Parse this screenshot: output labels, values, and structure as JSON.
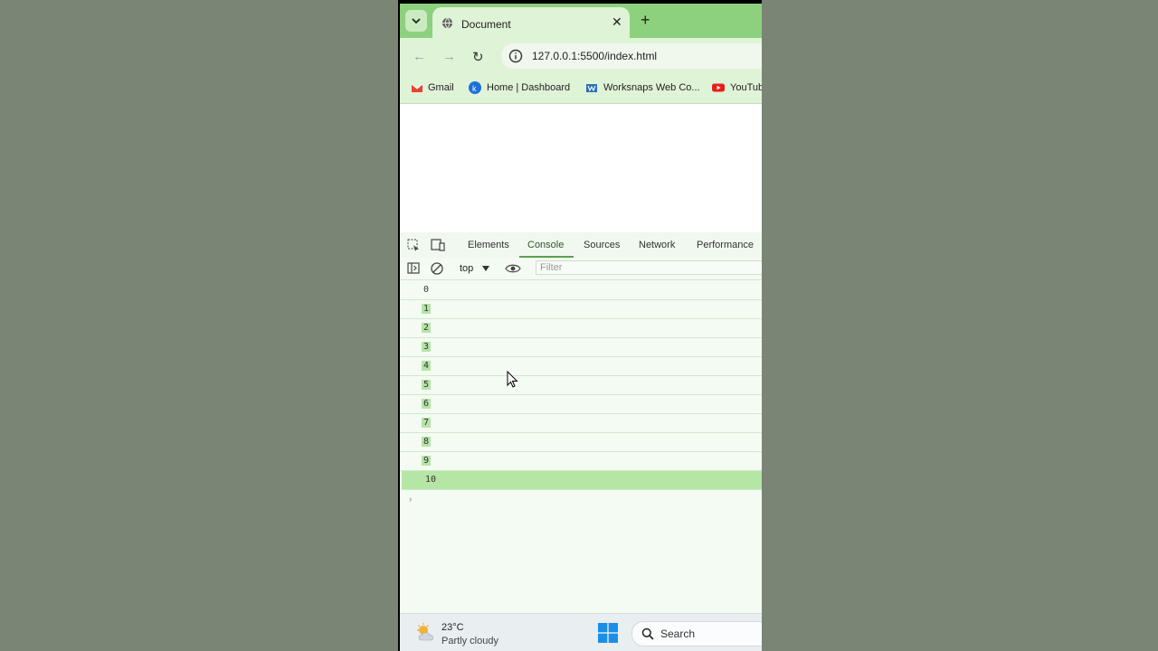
{
  "browser": {
    "tab_title": "Document",
    "url": "127.0.0.1:5500/index.html",
    "bookmarks": [
      {
        "label": "Gmail",
        "icon": "gmail-icon"
      },
      {
        "label": "Home | Dashboard",
        "icon": "k-icon"
      },
      {
        "label": "Worksnaps Web Co...",
        "icon": "worksnaps-icon"
      },
      {
        "label": "YouTub",
        "icon": "youtube-icon"
      }
    ]
  },
  "devtools": {
    "tabs": [
      "Elements",
      "Console",
      "Sources",
      "Network",
      "Performance"
    ],
    "active_tab": "Console",
    "context": "top",
    "filter_placeholder": "Filter",
    "logs": [
      "0",
      "1",
      "2",
      "3",
      "4",
      "5",
      "6",
      "7",
      "8",
      "9",
      "10"
    ]
  },
  "taskbar": {
    "temperature": "23°C",
    "weather": "Partly cloudy",
    "search_label": "Search"
  },
  "colors": {
    "accent": "#8dd17e",
    "highlight": "#b6e4a8"
  }
}
